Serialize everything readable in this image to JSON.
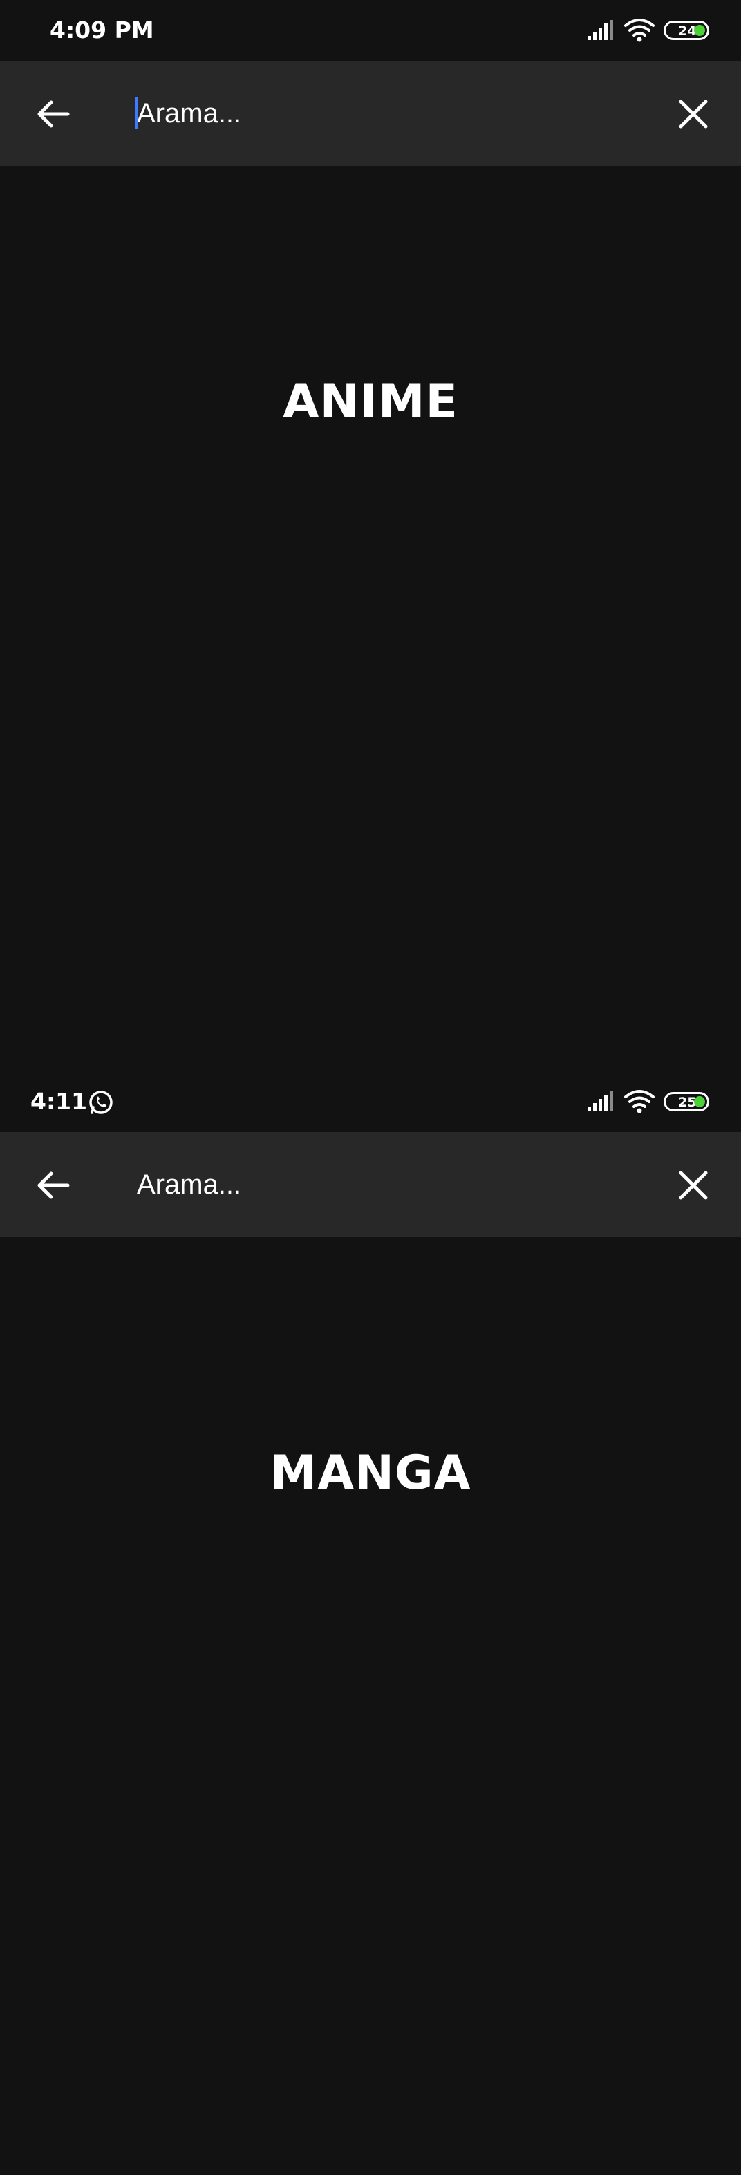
{
  "screens": [
    {
      "status": {
        "time": "4:09 PM",
        "battery": "24"
      },
      "search": {
        "placeholder": "Arama..."
      },
      "heading": "ANIME"
    },
    {
      "status": {
        "time": "4:11",
        "battery": "25"
      },
      "search": {
        "placeholder": "Arama..."
      },
      "heading": "MANGA"
    }
  ],
  "icons": {
    "back": "arrow-left-icon",
    "close": "close-icon",
    "signal": "signal-icon",
    "wifi": "wifi-icon",
    "battery": "battery-icon",
    "notification": "whatsapp-icon"
  },
  "colors": {
    "background": "#121212",
    "searchbar": "#282828",
    "cursor": "#3f7bff",
    "battery_charge": "#4cd137"
  }
}
